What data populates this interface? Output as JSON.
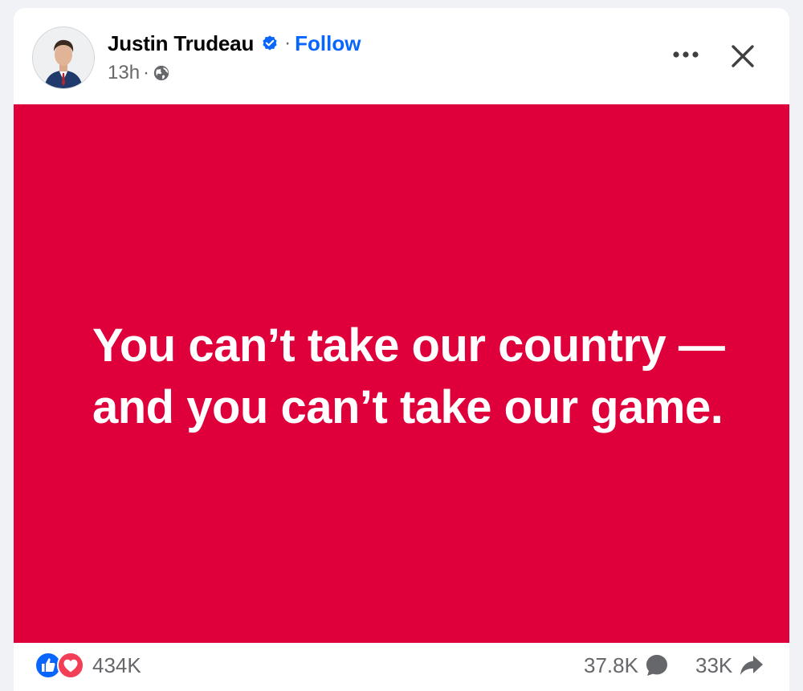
{
  "post": {
    "author_name": "Justin Trudeau",
    "separator": "·",
    "follow_label": "Follow",
    "timestamp": "13h",
    "meta_separator": "·",
    "audience_icon": "globe-icon",
    "verified_icon": "verified-badge-icon",
    "more_icon": "more-options-icon",
    "close_icon": "close-icon",
    "image_text_line1": "You can’t take our country —",
    "image_text_line2": "and you can’t take our game.",
    "image_background": "#df003b"
  },
  "engagement": {
    "reactions_count": "434K",
    "reaction_icons": [
      "like-icon",
      "love-icon"
    ],
    "comments_count": "37.8K",
    "comments_icon": "comment-icon",
    "shares_count": "33K",
    "shares_icon": "share-icon"
  },
  "colors": {
    "accent": "#0866ff",
    "secondary_text": "#65676b",
    "like": "#0866ff",
    "love": "#f33e58"
  }
}
